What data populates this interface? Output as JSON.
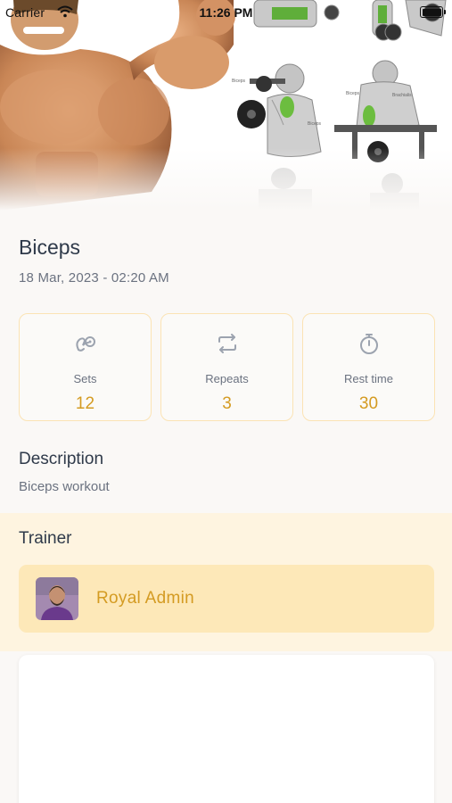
{
  "status_bar": {
    "carrier": "Carrier",
    "time": "11:26 PM"
  },
  "hero": {
    "image": "biceps-workout-illustration"
  },
  "workout": {
    "title": "Biceps",
    "date": "18 Mar, 2023 - 02:20 AM"
  },
  "stats": [
    {
      "label": "Sets",
      "value": "12",
      "icon": "sets-icon"
    },
    {
      "label": "Repeats",
      "value": "3",
      "icon": "repeat-icon"
    },
    {
      "label": "Rest time",
      "value": "30",
      "icon": "stopwatch-icon"
    }
  ],
  "description": {
    "heading": "Description",
    "text": "Biceps workout"
  },
  "trainer": {
    "heading": "Trainer",
    "name": "Royal Admin"
  },
  "colors": {
    "accent": "#d49b22",
    "card_border": "#fbe3b4",
    "trainer_bg": "#fef4e0",
    "trainer_card": "#fde8b8"
  }
}
